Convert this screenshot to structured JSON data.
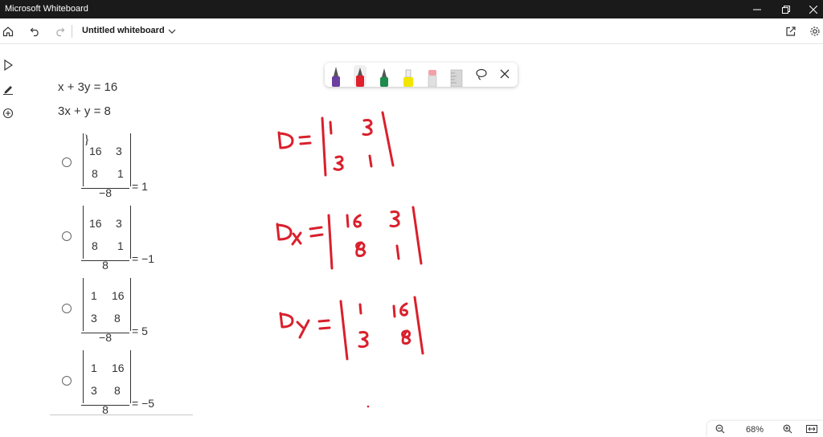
{
  "app": {
    "window_title": "Microsoft Whiteboard",
    "doc_title": "Untitled whiteboard"
  },
  "problem": {
    "equations": [
      "x + 3y = 16",
      "3x + y = 8"
    ],
    "options": [
      {
        "matrix": [
          [
            "16",
            "3"
          ],
          [
            "8",
            "1"
          ]
        ],
        "denominator": "−8",
        "result": "= 1"
      },
      {
        "matrix": [
          [
            "16",
            "3"
          ],
          [
            "8",
            "1"
          ]
        ],
        "denominator": "8",
        "result": "= −1"
      },
      {
        "matrix": [
          [
            "1",
            "16"
          ],
          [
            "3",
            "8"
          ]
        ],
        "denominator": "−8",
        "result": "= 5"
      },
      {
        "matrix": [
          [
            "1",
            "16"
          ],
          [
            "3",
            "8"
          ]
        ],
        "denominator": "8",
        "result": "= −5"
      }
    ]
  },
  "ink": {
    "d": {
      "label": "D =",
      "matrix": [
        [
          "1",
          "3"
        ],
        [
          "3",
          "1"
        ]
      ]
    },
    "dx": {
      "label": "Dx =",
      "matrix": [
        [
          "16",
          "3"
        ],
        [
          "8",
          "1"
        ]
      ]
    },
    "dy": {
      "label": "Dy =",
      "matrix": [
        [
          "1",
          "16"
        ],
        [
          "3",
          "8"
        ]
      ]
    },
    "color": "#d9202c"
  },
  "pen_colors": [
    "#6b3fa0",
    "#e0202c",
    "#1e8a4c",
    "#f2e600",
    "#f4a0a8",
    "#cfcfcf"
  ],
  "zoom": {
    "level": "68%"
  }
}
